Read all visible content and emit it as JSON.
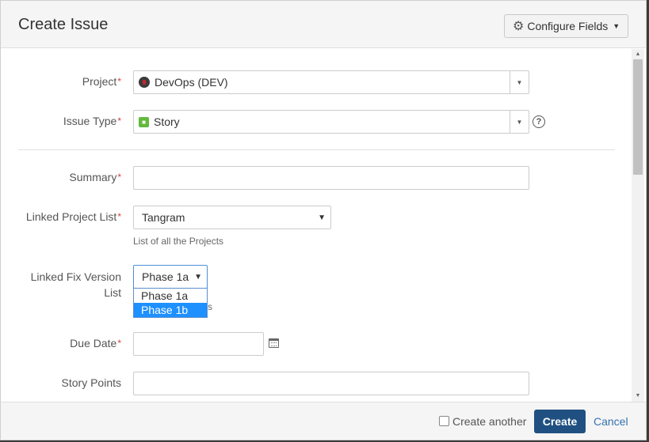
{
  "dialog": {
    "title": "Create Issue",
    "configure_fields_label": "Configure Fields"
  },
  "icons": {
    "configure": "gear-icon",
    "project": "project-avatar-icon",
    "issue_type": "story-icon",
    "help": "help-icon",
    "calendar": "calendar-icon"
  },
  "fields": {
    "project": {
      "label": "Project",
      "required": "*",
      "value": "DevOps (DEV)"
    },
    "issue_type": {
      "label": "Issue Type",
      "required": "*",
      "value": "Story"
    },
    "summary": {
      "label": "Summary",
      "required": "*",
      "value": ""
    },
    "linked_project_list": {
      "label": "Linked Project List",
      "required": "*",
      "value": "Tangram",
      "description": "List of all the Projects"
    },
    "linked_fix_version_list": {
      "label_line1": "Linked Fix Version",
      "label_line2": "List",
      "value": "Phase 1a",
      "options": [
        "Phase 1a",
        "Phase 1b"
      ],
      "highlighted_option": "Phase 1b",
      "description_tail": "s"
    },
    "due_date": {
      "label": "Due Date",
      "required": "*",
      "value": ""
    },
    "story_points": {
      "label": "Story Points",
      "value": ""
    }
  },
  "footer": {
    "create_another_label": "Create another",
    "create_another_checked": false,
    "create_label": "Create",
    "cancel_label": "Cancel"
  },
  "colors": {
    "primary_button": "#205081",
    "link": "#3572b0",
    "required": "#d04437",
    "highlight": "#1e90ff"
  }
}
